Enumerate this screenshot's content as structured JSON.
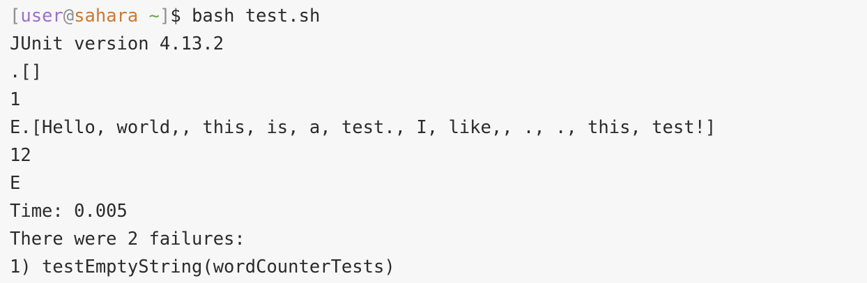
{
  "prompt": {
    "open": "[",
    "user": "user",
    "at": "@",
    "host": "sahara",
    "space": " ",
    "cwd": "~",
    "close": "]",
    "symbol": "$ ",
    "command": "bash test.sh"
  },
  "output": [
    "JUnit version 4.13.2",
    ".[]",
    "1",
    "E.[Hello, world,, this, is, a, test., I, like,, ., ., this, test!]",
    "12",
    "E",
    "Time: 0.005",
    "There were 2 failures:",
    "1) testEmptyString(wordCounterTests)"
  ],
  "colors": {
    "background": "#f7f7f7",
    "text": "#2b2b2b",
    "user": "#9a6fd0",
    "host": "#c97a33",
    "cwd": "#6aa84f",
    "bracket": "#8f8f8f"
  }
}
